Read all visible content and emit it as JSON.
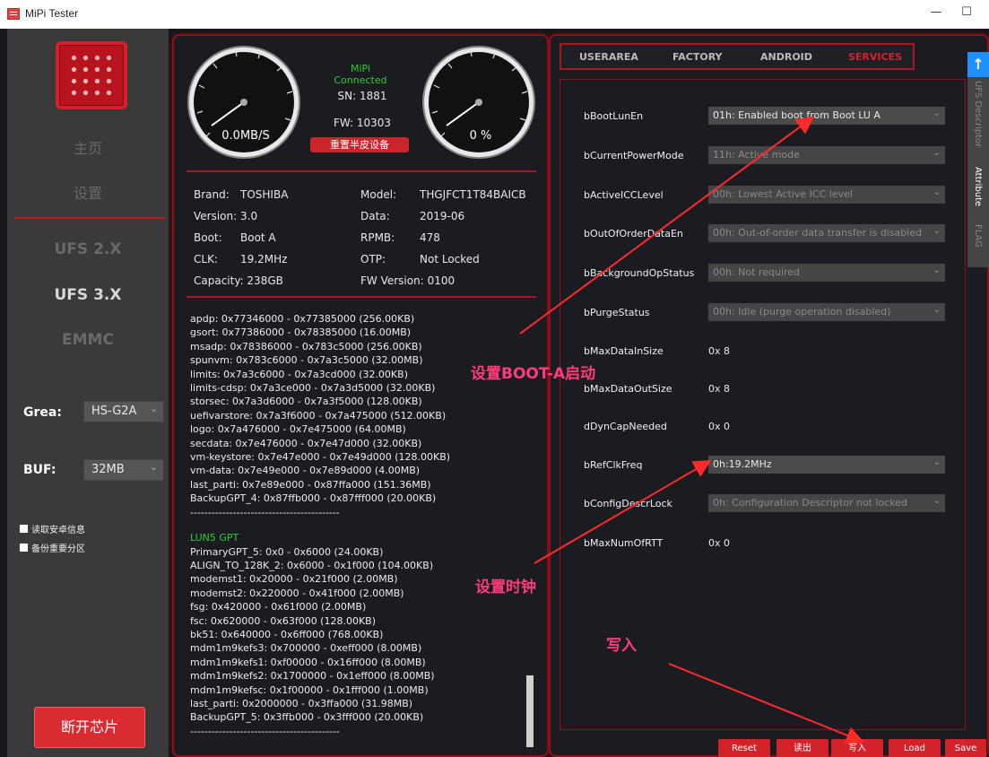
{
  "window": {
    "title": "MiPi Tester",
    "minimize": "—",
    "maximize": "☐"
  },
  "sidebar": {
    "home": "主页",
    "settings": "设置",
    "ufs2": "UFS 2.X",
    "ufs3": "UFS 3.X",
    "emmc": "EMMC",
    "grea_label": "Grea:",
    "grea_value": "HS-G2A",
    "buf_label": "BUF:",
    "buf_value": "32MB",
    "chk_read": "读取安卓信息",
    "chk_backup": "备份重要分区",
    "disconnect": "断开芯片"
  },
  "device": {
    "status": "MiPi Connected",
    "sn": "SN: 1881",
    "fw": "FW: 10303",
    "reset": "重置半皮设备",
    "speed": "0.0MB/S",
    "progress": "0 %",
    "brand_l": "Brand:",
    "brand_v": "TOSHIBA",
    "model_l": "Model:",
    "model_v": "THGJFCT1T84BAICB",
    "version_l": "Version:",
    "version_v": "3.0",
    "data_l": "Data:",
    "data_v": "2019-06",
    "boot_l": "Boot:",
    "boot_v": "Boot A",
    "rpmb_l": "RPMB:",
    "rpmb_v": "478",
    "clk_l": "CLK:",
    "clk_v": "19.2MHz",
    "otp_l": "OTP:",
    "otp_v": "Not Locked",
    "capacity": "Capacity: 238GB",
    "fwver": "FW Version: 0100"
  },
  "log": {
    "block1": "apdp: 0x77346000 - 0x77385000 (256.00KB)\ngsort: 0x77386000 - 0x78385000 (16.00MB)\nmsadp: 0x78386000 - 0x783c5000 (256.00KB)\nspunvm: 0x783c6000 - 0x7a3c5000 (32.00MB)\nlimits: 0x7a3c6000 - 0x7a3cd000 (32.00KB)\nlimits-cdsp: 0x7a3ce000 - 0x7a3d5000 (32.00KB)\nstorsec: 0x7a3d6000 - 0x7a3f5000 (128.00KB)\nuefivarstore: 0x7a3f6000 - 0x7a475000 (512.00KB)\nlogo: 0x7a476000 - 0x7e475000 (64.00MB)\nsecdata: 0x7e476000 - 0x7e47d000 (32.00KB)\nvm-keystore: 0x7e47e000 - 0x7e49d000 (128.00KB)\nvm-data: 0x7e49e000 - 0x7e89d000 (4.00MB)\nlast_parti: 0x7e89e000 - 0x87ffa000 (151.36MB)\nBackupGPT_4: 0x87ffb000 - 0x87fff000 (20.00KB)\n------------------------------------------",
    "lun5": "LUN5 GPT",
    "block2": "PrimaryGPT_5: 0x0 - 0x6000 (24.00KB)\nALIGN_TO_128K_2: 0x6000 - 0x1f000 (104.00KB)\nmodemst1: 0x20000 - 0x21f000 (2.00MB)\nmodemst2: 0x220000 - 0x41f000 (2.00MB)\nfsg: 0x420000 - 0x61f000 (2.00MB)\nfsc: 0x620000 - 0x63f000 (128.00KB)\nbk51: 0x640000 - 0x6ff000 (768.00KB)\nmdm1m9kefs3: 0x700000 - 0xeff000 (8.00MB)\nmdm1m9kefs1: 0xf00000 - 0x16ff000 (8.00MB)\nmdm1m9kefs2: 0x1700000 - 0x1eff000 (8.00MB)\nmdm1m9kefsc: 0x1f00000 - 0x1fff000 (1.00MB)\nlast_parti: 0x2000000 - 0x3ffa000 (31.98MB)\nBackupGPT_5: 0x3ffb000 - 0x3fff000 (20.00KB)\n------------------------------------------"
  },
  "tabs": {
    "userarea": "USERAREA",
    "factory": "FACTORY",
    "android": "ANDROID",
    "services": "SERVICES"
  },
  "sidetab": {
    "up": "↑",
    "ufs": "UFS Descriptor",
    "attr": "Attribute",
    "flag": "FLAG"
  },
  "attributes": {
    "bBootLunEn": {
      "label": "bBootLunEn",
      "value": "01h: Enabled boot from Boot LU A"
    },
    "bCurrentPowerMode": {
      "label": "bCurrentPowerMode",
      "value": "11h: Active mode"
    },
    "bActiveICCLevel": {
      "label": "bActiveICCLevel",
      "value": "00h: Lowest Active ICC level"
    },
    "bOutOfOrderDataEn": {
      "label": "bOutOfOrderDataEn",
      "value": "00h: Out-of-order data transfer is disabled"
    },
    "bBackgroundOpStatus": {
      "label": "bBackgroundOpStatus",
      "value": "00h: Not required"
    },
    "bPurgeStatus": {
      "label": "bPurgeStatus",
      "value": "00h: Idle (purge operation disabled)"
    },
    "bMaxDataInSize": {
      "label": "bMaxDataInSize",
      "value": "0x 8"
    },
    "bMaxDataOutSize": {
      "label": "bMaxDataOutSize",
      "value": "0x 8"
    },
    "dDynCapNeeded": {
      "label": "dDynCapNeeded",
      "value": "0x 0"
    },
    "bRefClkFreq": {
      "label": "bRefClkFreq",
      "value": "0h:19.2MHz"
    },
    "bConfigDescrLock": {
      "label": "bConfigDescrLock",
      "value": "0h: Configuration Descriptor not locked"
    },
    "bMaxNumOfRTT": {
      "label": "bMaxNumOfRTT",
      "value": "0x 0"
    }
  },
  "buttons": {
    "reset": "Reset",
    "read": "读出",
    "write": "写入",
    "load": "Load",
    "save": "Save"
  },
  "annotations": {
    "boot": "设置BOOT-A启动",
    "clock": "设置时钟",
    "write": "写入"
  },
  "colors": {
    "accent": "#d8202a",
    "annotation": "#ff3b7a",
    "connected": "#2ecc2e"
  }
}
